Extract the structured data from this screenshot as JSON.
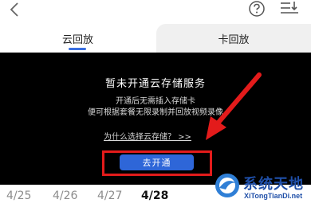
{
  "header": {
    "back_icon": "chevron-left-icon",
    "help_icon": "question-circle-icon",
    "sort_icon": "sort-list-icon"
  },
  "tabs": [
    {
      "label": "云回放",
      "active": true
    },
    {
      "label": "卡回放",
      "active": false
    }
  ],
  "panel": {
    "title": "暂未开通云存储服务",
    "desc_line1": "开通后无需插入存储卡",
    "desc_line2": "便可根据套餐无限录制并回放视频录像",
    "why_link": "为什么选择云存储？ >>",
    "open_button": "去开通"
  },
  "dates": [
    "4/25",
    "4/26",
    "4/27",
    "4/28"
  ],
  "selected_date": "4/28",
  "watermark": {
    "name": "系统天地",
    "site": "XiTongTianDi.net"
  },
  "colors": {
    "accent": "#2e66d8",
    "highlight": "#e31b1b",
    "panel_bg": "#000000"
  }
}
